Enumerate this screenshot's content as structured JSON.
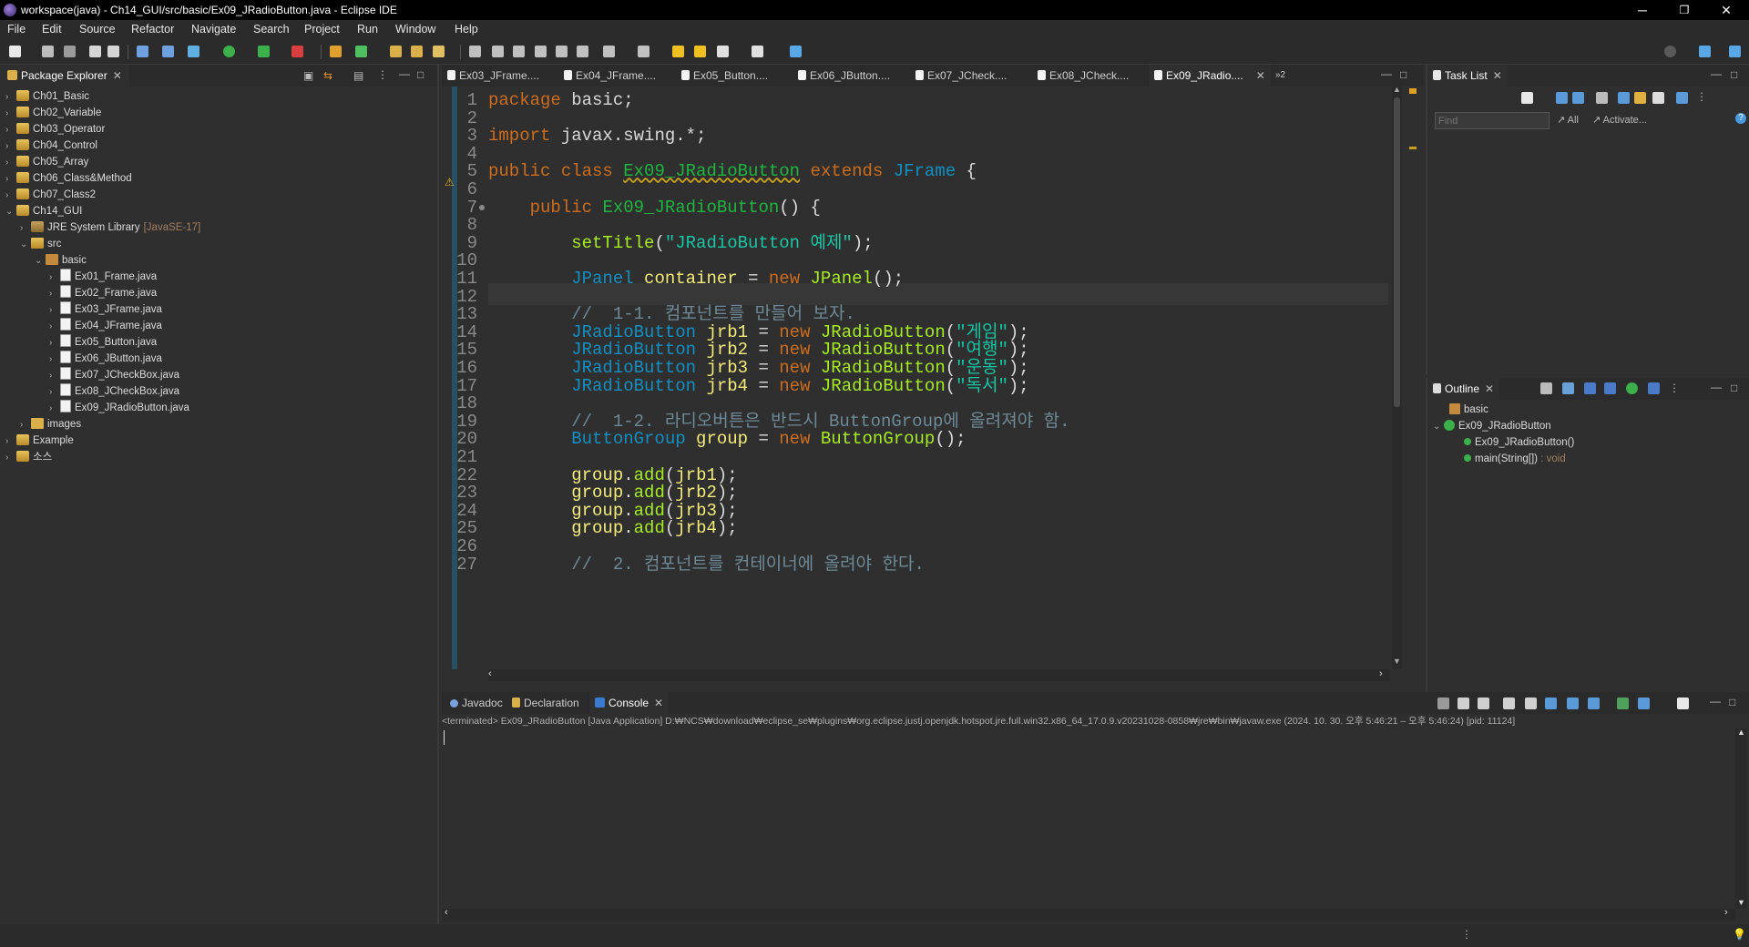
{
  "window": {
    "title": "workspace(java) - Ch14_GUI/src/basic/Ex09_JRadioButton.java - Eclipse IDE",
    "minimize": "─",
    "restore": "❐",
    "close": "✕"
  },
  "menu": [
    "File",
    "Edit",
    "Source",
    "Refactor",
    "Navigate",
    "Search",
    "Project",
    "Run",
    "Window",
    "Help"
  ],
  "package_explorer": {
    "title": "Package Explorer",
    "items": [
      {
        "label": "Ch01_Basic",
        "depth": 0,
        "arrow": "›",
        "icon": "proj"
      },
      {
        "label": "Ch02_Variable",
        "depth": 0,
        "arrow": "›",
        "icon": "proj"
      },
      {
        "label": "Ch03_Operator",
        "depth": 0,
        "arrow": "›",
        "icon": "proj"
      },
      {
        "label": "Ch04_Control",
        "depth": 0,
        "arrow": "›",
        "icon": "proj"
      },
      {
        "label": "Ch05_Array",
        "depth": 0,
        "arrow": "›",
        "icon": "proj"
      },
      {
        "label": "Ch06_Class&Method",
        "depth": 0,
        "arrow": "›",
        "icon": "proj"
      },
      {
        "label": "Ch07_Class2",
        "depth": 0,
        "arrow": "›",
        "icon": "proj"
      },
      {
        "label": "Ch14_GUI",
        "depth": 0,
        "arrow": "⌄",
        "icon": "proj"
      },
      {
        "label": "JRE System Library",
        "suffix": "[JavaSE-17]",
        "depth": 1,
        "arrow": "›",
        "icon": "jre"
      },
      {
        "label": "src",
        "depth": 1,
        "arrow": "⌄",
        "icon": "src"
      },
      {
        "label": "basic",
        "depth": 2,
        "arrow": "⌄",
        "icon": "pkg"
      },
      {
        "label": "Ex01_Frame.java",
        "depth": 3,
        "arrow": "›",
        "icon": "jfile"
      },
      {
        "label": "Ex02_Frame.java",
        "depth": 3,
        "arrow": "›",
        "icon": "jfile"
      },
      {
        "label": "Ex03_JFrame.java",
        "depth": 3,
        "arrow": "›",
        "icon": "jfile"
      },
      {
        "label": "Ex04_JFrame.java",
        "depth": 3,
        "arrow": "›",
        "icon": "jfile"
      },
      {
        "label": "Ex05_Button.java",
        "depth": 3,
        "arrow": "›",
        "icon": "jfile"
      },
      {
        "label": "Ex06_JButton.java",
        "depth": 3,
        "arrow": "›",
        "icon": "jfile"
      },
      {
        "label": "Ex07_JCheckBox.java",
        "depth": 3,
        "arrow": "›",
        "icon": "jfile"
      },
      {
        "label": "Ex08_JCheckBox.java",
        "depth": 3,
        "arrow": "›",
        "icon": "jfile"
      },
      {
        "label": "Ex09_JRadioButton.java",
        "depth": 3,
        "arrow": "›",
        "icon": "jfile"
      },
      {
        "label": "images",
        "depth": 1,
        "arrow": "›",
        "icon": "folder"
      },
      {
        "label": "Example",
        "depth": 0,
        "arrow": "›",
        "icon": "proj"
      },
      {
        "label": "소스",
        "depth": 0,
        "arrow": "›",
        "icon": "proj"
      }
    ]
  },
  "editor_tabs": [
    {
      "label": "Ex03_JFrame...."
    },
    {
      "label": "Ex04_JFrame...."
    },
    {
      "label": "Ex05_Button...."
    },
    {
      "label": "Ex06_JButton...."
    },
    {
      "label": "Ex07_JCheck...."
    },
    {
      "label": "Ex08_JCheck...."
    },
    {
      "label": "Ex09_JRadio...."
    }
  ],
  "editor_overflow": "»2",
  "code": [
    {
      "n": "1",
      "html": "<span class='kw'>package</span> basic;"
    },
    {
      "n": "2",
      "html": ""
    },
    {
      "n": "3",
      "html": "<span class='kw'>import</span> javax.swing.*;"
    },
    {
      "n": "4",
      "html": ""
    },
    {
      "n": "5",
      "html": "<span class='kw'>public class</span> <span class='cl' style='text-decoration:underline wavy #c9a21a'>Ex09_JRadioButton</span> <span class='kw'>extends</span> <span class='ty'>JFrame</span> {"
    },
    {
      "n": "6",
      "html": ""
    },
    {
      "n": "7",
      "html": "    <span class='kw'>public</span> <span class='cl'>Ex09_JRadioButton</span>() {"
    },
    {
      "n": "8",
      "html": ""
    },
    {
      "n": "9",
      "html": "        <span class='me'>setTitle</span>(<span class='st'>\"JRadioButton 예제\"</span>);"
    },
    {
      "n": "10",
      "html": ""
    },
    {
      "n": "11",
      "html": "        <span class='ty'>JPanel</span> <span class='var'>container</span> = <span class='kw'>new</span> <span class='me'>JPanel</span>();"
    },
    {
      "n": "12",
      "html": ""
    },
    {
      "n": "13",
      "html": "        <span class='cm'>//  1-1. 컴포넌트를 만들어 보자.</span>"
    },
    {
      "n": "14",
      "html": "        <span class='ty'>JRadioButton</span> <span class='var'>jrb1</span> = <span class='kw'>new</span> <span class='me'>JRadioButton</span>(<span class='st'>\"게임\"</span>);"
    },
    {
      "n": "15",
      "html": "        <span class='ty'>JRadioButton</span> <span class='var'>jrb2</span> = <span class='kw'>new</span> <span class='me'>JRadioButton</span>(<span class='st'>\"여행\"</span>);"
    },
    {
      "n": "16",
      "html": "        <span class='ty'>JRadioButton</span> <span class='var'>jrb3</span> = <span class='kw'>new</span> <span class='me'>JRadioButton</span>(<span class='st'>\"운동\"</span>);"
    },
    {
      "n": "17",
      "html": "        <span class='ty'>JRadioButton</span> <span class='var'>jrb4</span> = <span class='kw'>new</span> <span class='me'>JRadioButton</span>(<span class='st'>\"독서\"</span>);"
    },
    {
      "n": "18",
      "html": ""
    },
    {
      "n": "19",
      "html": "        <span class='cm'>//  1-2. 라디오버튼은 반드시 ButtonGroup에 올려져야 함.</span>"
    },
    {
      "n": "20",
      "html": "        <span class='ty'>ButtonGroup</span> <span class='var'>group</span> = <span class='kw'>new</span> <span class='me'>ButtonGroup</span>();"
    },
    {
      "n": "21",
      "html": ""
    },
    {
      "n": "22",
      "html": "        <span class='var'>group</span>.<span class='me'>add</span>(<span class='var'>jrb1</span>);"
    },
    {
      "n": "23",
      "html": "        <span class='var'>group</span>.<span class='me'>add</span>(<span class='var'>jrb2</span>);"
    },
    {
      "n": "24",
      "html": "        <span class='var'>group</span>.<span class='me'>add</span>(<span class='var'>jrb3</span>);"
    },
    {
      "n": "25",
      "html": "        <span class='var'>group</span>.<span class='me'>add</span>(<span class='var'>jrb4</span>);"
    },
    {
      "n": "26",
      "html": ""
    },
    {
      "n": "27",
      "html": "        <span class='cm'>//  2. 컴포넌트를 컨테이너에 올려야 한다.</span>"
    }
  ],
  "task_list": {
    "title": "Task List",
    "find_placeholder": "Find",
    "all": "All",
    "activate": "Activate..."
  },
  "outline": {
    "title": "Outline",
    "items": [
      {
        "label": "basic"
      },
      {
        "label": "Ex09_JRadioButton"
      },
      {
        "label": "Ex09_JRadioButton()"
      },
      {
        "label": "main(String[])",
        "suffix": " : void"
      }
    ]
  },
  "bottom_tabs": [
    "Javadoc",
    "Declaration",
    "Console"
  ],
  "console": {
    "status": "<terminated> Ex09_JRadioButton [Java Application] D:₩NCS₩download₩eclipse_se₩plugins₩org.eclipse.justj.openjdk.hotspot.jre.full.win32.x86_64_17.0.9.v20231028-0858₩jre₩bin₩javaw.exe  (2024. 10. 30. 오후 5:46:21 – 오후 5:46:24) [pid: 11124]"
  },
  "colors": {
    "keyword": "#cc6c1d",
    "type": "#1290c3",
    "string": "#17c6a3",
    "method": "#a7ec21",
    "comment": "#6e8a96",
    "variable": "#f3ec79"
  }
}
